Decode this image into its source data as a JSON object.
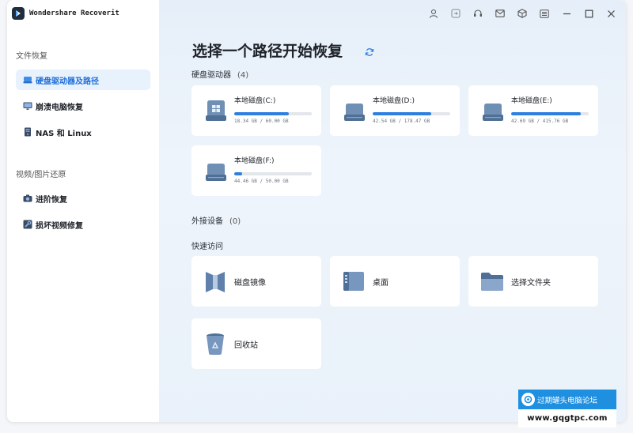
{
  "app": {
    "title": "Wondershare Recoverit",
    "logo_icon": "recoverit-logo-icon"
  },
  "sidebar": {
    "section_file_recovery": "文件恢复",
    "section_video_photo": "视频/图片还原",
    "items": [
      {
        "label": "硬盘驱动器及路径",
        "icon": "hard-drive-icon",
        "active": true
      },
      {
        "label": "崩溃电脑恢复",
        "icon": "monitor-icon",
        "active": false
      },
      {
        "label": "NAS 和 Linux",
        "icon": "nas-icon",
        "active": false
      },
      {
        "label": "进阶恢复",
        "icon": "camera-icon",
        "active": false
      },
      {
        "label": "损坏视频修复",
        "icon": "video-repair-icon",
        "active": false
      }
    ]
  },
  "topbar": {
    "icons": [
      "user-icon",
      "login-icon",
      "headset-icon",
      "mail-icon",
      "cube-icon",
      "list-icon",
      "minimize-icon",
      "maximize-icon",
      "close-icon"
    ]
  },
  "main": {
    "title": "选择一个路径开始恢复",
    "refresh_icon": "refresh-icon",
    "drives_label": "硬盘驱动器",
    "drives_count": "(4)",
    "drives": [
      {
        "name": "本地磁盘(C:)",
        "used": "18.34 GB",
        "total": "60.00 GB",
        "size_text": "18.34 GB / 60.00 GB",
        "fill_fraction": 0.7,
        "icon": "windows-drive-icon"
      },
      {
        "name": "本地磁盘(D:)",
        "used": "42.54 GB",
        "total": "178.47 GB",
        "size_text": "42.54 GB / 178.47 GB",
        "fill_fraction": 0.76,
        "icon": "drive-icon"
      },
      {
        "name": "本地磁盘(E:)",
        "used": "42.69 GB",
        "total": "415.76 GB",
        "size_text": "42.69 GB / 415.76 GB",
        "fill_fraction": 0.9,
        "icon": "drive-icon"
      },
      {
        "name": "本地磁盘(F:)",
        "used": "44.46 GB",
        "total": "50.00 GB",
        "size_text": "44.46 GB / 50.00 GB",
        "fill_fraction": 0.1,
        "icon": "drive-icon"
      }
    ],
    "external_label": "外接设备",
    "external_count": "(0)",
    "quick_label": "快速访问",
    "quick_items": [
      {
        "label": "磁盘镜像",
        "icon": "disk-image-icon"
      },
      {
        "label": "桌面",
        "icon": "desktop-icon"
      },
      {
        "label": "选择文件夹",
        "icon": "folder-icon"
      },
      {
        "label": "回收站",
        "icon": "recycle-bin-icon"
      }
    ]
  },
  "watermark": {
    "line1": "过期罐头电脑论坛",
    "line2": "www.gqgtpc.com"
  },
  "colors": {
    "accent": "#2d7fe0",
    "active_bg": "#e8f2fd",
    "main_bg": "#e9f1fa"
  }
}
